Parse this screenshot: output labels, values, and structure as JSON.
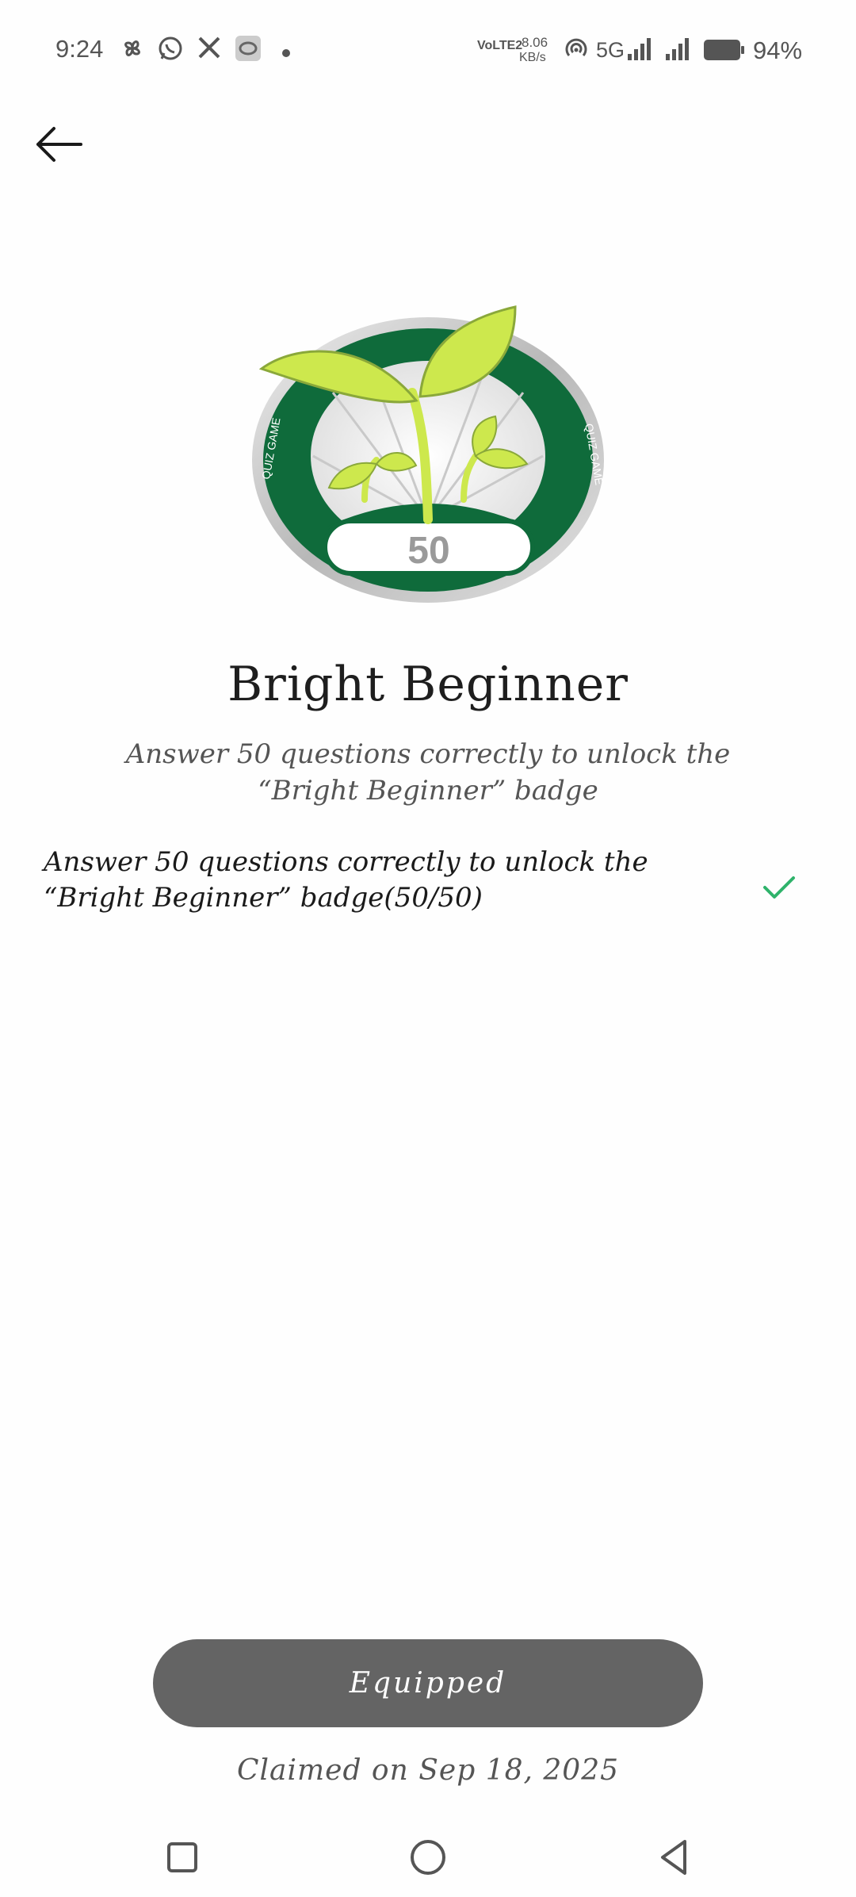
{
  "status_bar": {
    "time": "9:24",
    "network_label": "VoLTE2",
    "speed_value": "8.06",
    "speed_unit": "KB/s",
    "network_type": "5G",
    "battery_percent": "94%",
    "icons": [
      "pinwheel-icon",
      "whatsapp-icon",
      "x-icon",
      "app-icon",
      "dot-icon",
      "hotspot-icon",
      "signal-icon",
      "signal-icon",
      "battery-icon"
    ]
  },
  "header": {
    "back_icon": "arrow-left-icon"
  },
  "badge": {
    "title": "Bright Beginner",
    "subtitle": "Answer 50 questions correctly to unlock the “Bright Beginner” badge",
    "image_label_left": "QUIZ GAME",
    "image_label_right": "QUIZ GAME",
    "image_number": "50"
  },
  "requirement": {
    "text": "Answer 50 questions correctly to unlock the “Bright Beginner” badge(50/50)",
    "completed": true,
    "check_color": "#2fb36b"
  },
  "actions": {
    "equip_label": "Equipped",
    "claimed_text": "Claimed on Sep 18, 2025"
  },
  "nav": {
    "items": [
      "recents-icon",
      "home-icon",
      "back-icon"
    ]
  }
}
